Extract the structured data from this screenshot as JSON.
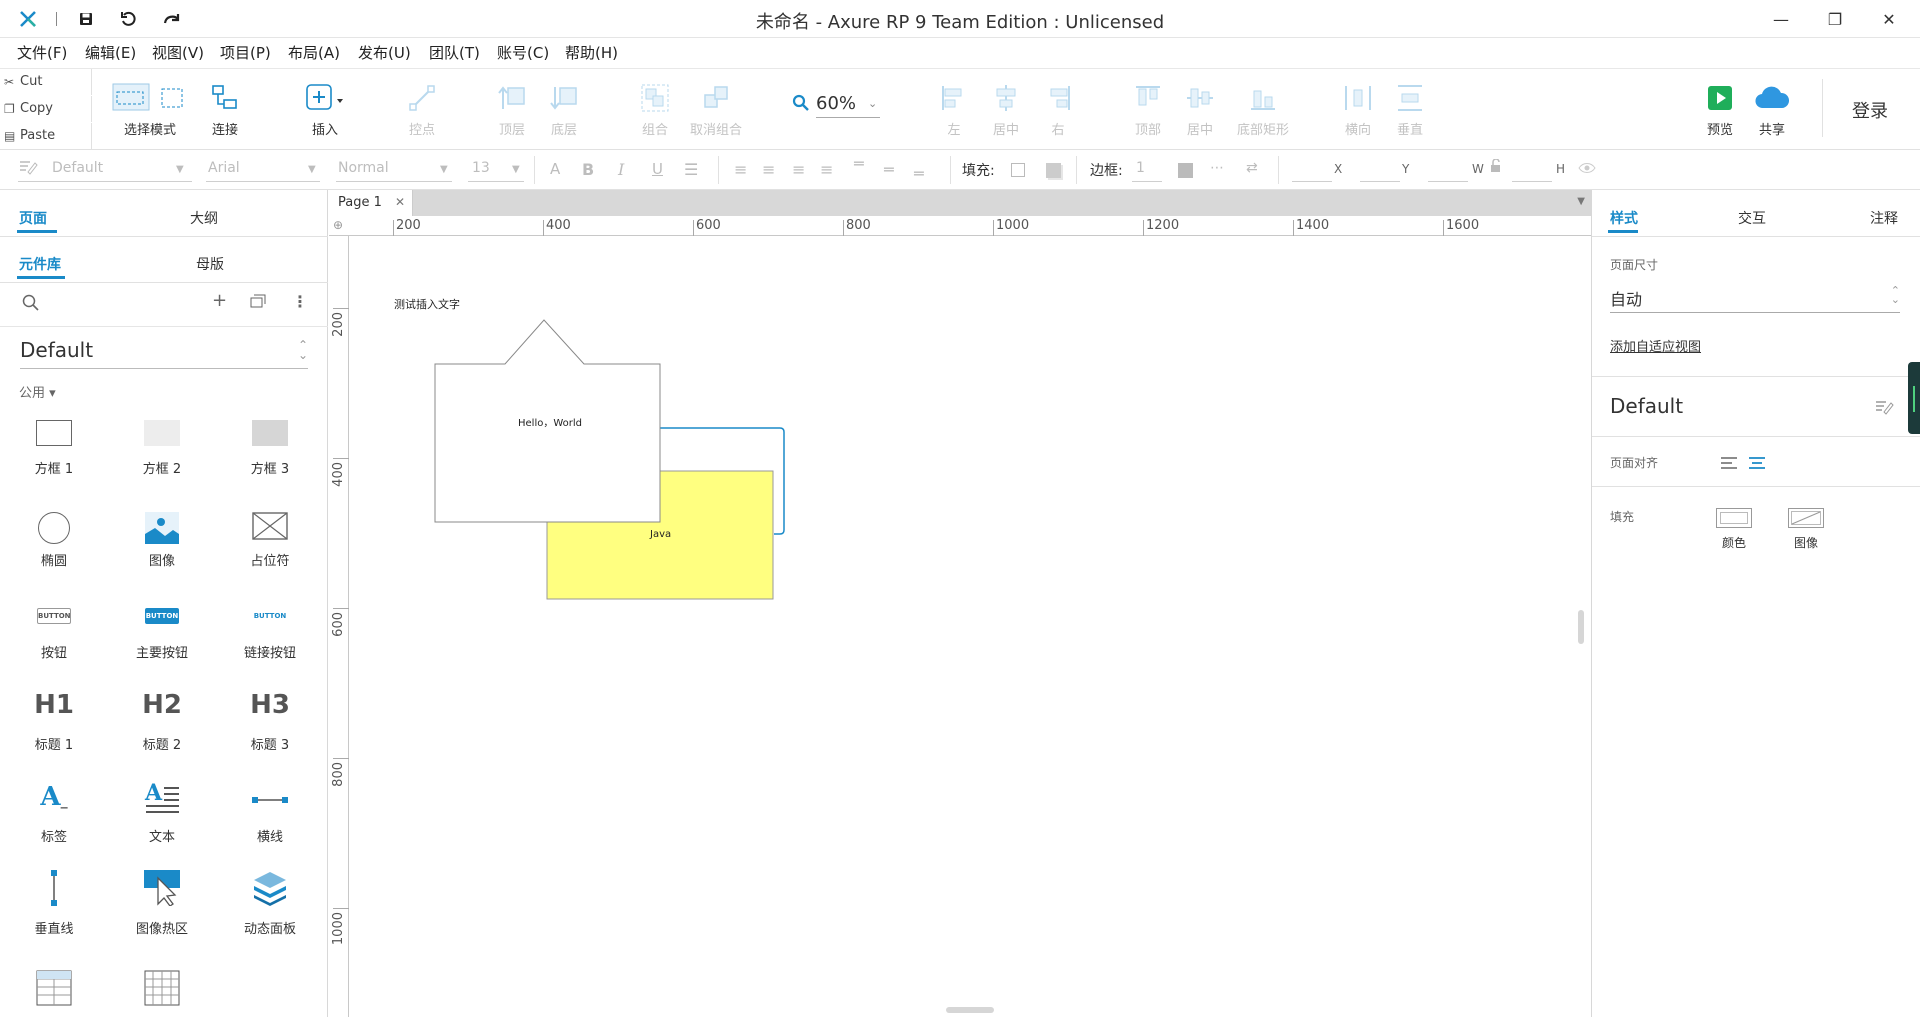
{
  "window": {
    "title": "未命名 - Axure RP 9 Team Edition : Unlicensed",
    "minimize": "—",
    "restore": "❐",
    "close": "✕"
  },
  "menu": [
    "文件(F)",
    "编辑(E)",
    "视图(V)",
    "项目(P)",
    "布局(A)",
    "发布(U)",
    "团队(T)",
    "账号(C)",
    "帮助(H)"
  ],
  "clipboard": {
    "cut": "Cut",
    "copy": "Copy",
    "paste": "Paste"
  },
  "toolbar": {
    "select_mode": "选择模式",
    "connect": "连接",
    "insert": "插入",
    "point": "控点",
    "top_layer": "顶层",
    "bottom_layer": "底层",
    "group": "组合",
    "ungroup": "取消组合",
    "zoom": "60%",
    "align_left": "左",
    "align_center": "居中",
    "align_right": "右",
    "align_top": "顶部",
    "align_middle": "居中",
    "align_bottom": "底部矩形",
    "distribute_h": "横向",
    "distribute_v": "垂直",
    "preview": "预览",
    "share": "共享",
    "login": "登录"
  },
  "format": {
    "style": "Default",
    "font": "Arial",
    "weight": "Normal",
    "size": "13",
    "fill_label": "填充:",
    "border_label": "边框:",
    "border_value": "1",
    "x": "X",
    "y": "Y",
    "w": "W",
    "h": "H"
  },
  "left_panel": {
    "tabs": [
      "页面",
      "大纲"
    ],
    "subtabs": [
      "元件库",
      "母版"
    ],
    "library": "Default",
    "category": "公用 ▾",
    "widgets": [
      {
        "label": "方框 1",
        "icon": "box1-icon"
      },
      {
        "label": "方框 2",
        "icon": "box2-icon"
      },
      {
        "label": "方框 3",
        "icon": "box3-icon"
      },
      {
        "label": "椭圆",
        "icon": "ellipse-icon"
      },
      {
        "label": "图像",
        "icon": "image-icon"
      },
      {
        "label": "占位符",
        "icon": "placeholder-icon"
      },
      {
        "label": "按钮",
        "icon": "button-icon"
      },
      {
        "label": "主要按钮",
        "icon": "primary-button-icon"
      },
      {
        "label": "链接按钮",
        "icon": "link-button-icon"
      },
      {
        "label": "标题 1",
        "icon": "h1-icon"
      },
      {
        "label": "标题 2",
        "icon": "h2-icon"
      },
      {
        "label": "标题 3",
        "icon": "h3-icon"
      },
      {
        "label": "标签",
        "icon": "label-icon"
      },
      {
        "label": "文本",
        "icon": "text-icon"
      },
      {
        "label": "横线",
        "icon": "hline-icon"
      },
      {
        "label": "垂直线",
        "icon": "vline-icon"
      },
      {
        "label": "图像热区",
        "icon": "hotspot-icon"
      },
      {
        "label": "动态面板",
        "icon": "dynamic-panel-icon"
      }
    ],
    "widget_glyphs": {
      "button": "BUTTON",
      "h1": "H1",
      "h2": "H2",
      "h3": "H3",
      "label": "A",
      "text": "A"
    }
  },
  "canvas": {
    "page_tab": "Page 1",
    "h_ruler": [
      "200",
      "400",
      "600",
      "800",
      "1000",
      "1200",
      "1400",
      "1600"
    ],
    "v_ruler": [
      "200",
      "400",
      "600",
      "800",
      "1000"
    ],
    "text_label": "测试插入文字",
    "shape_text": "Hello，World",
    "java_text": "Java"
  },
  "right_panel": {
    "tabs": [
      "样式",
      "交互",
      "注释"
    ],
    "page_size_label": "页面尺寸",
    "page_size_value": "自动",
    "adaptive_link": "添加自适应视图",
    "style_name": "Default",
    "page_align_label": "页面对齐",
    "fill_label": "填充",
    "fill_color": "颜色",
    "fill_image": "图像"
  },
  "colors": {
    "accent": "#1a8ac8",
    "preview_green": "#1fae5a",
    "share_blue": "#2f97e0",
    "java_yellow": "#ffff80",
    "selection_blue": "#1a8ac8"
  }
}
